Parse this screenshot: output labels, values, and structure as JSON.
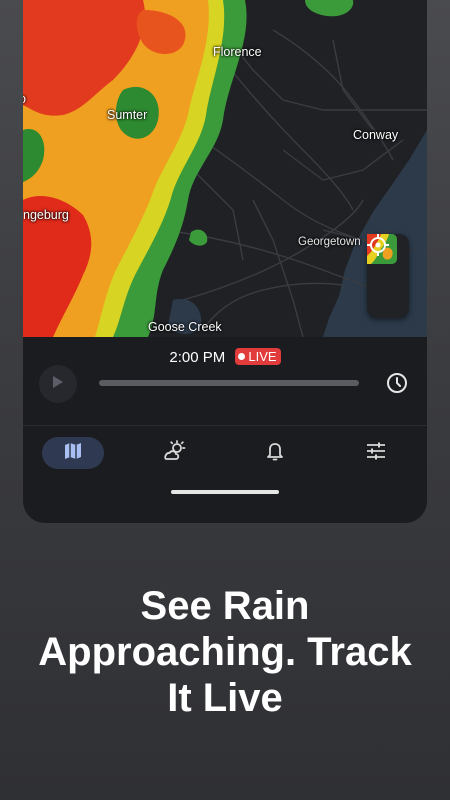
{
  "map": {
    "cities": {
      "florence": "Florence",
      "sumter": "Sumter",
      "conway": "Conway",
      "orangeburg": "ngeburg",
      "georgetown": "Georgetown",
      "goose_creek": "Goose Creek",
      "edge_fragment": "o"
    },
    "layer_button_icon": "radar-layer-thumbnail-icon",
    "locate_button_icon": "crosshair-icon"
  },
  "player": {
    "time": "2:00 PM",
    "live_label": "LIVE",
    "live_color": "#e23b3b",
    "progress": 1.0
  },
  "nav": {
    "items": [
      {
        "icon": "map-icon",
        "active": true
      },
      {
        "icon": "weather-icon",
        "active": false
      },
      {
        "icon": "bell-icon",
        "active": false
      },
      {
        "icon": "sliders-icon",
        "active": false
      }
    ],
    "active_color": "#2f3a52"
  },
  "headline": {
    "line1": "See Rain",
    "line2": "Approaching. Track",
    "line3": "It Live"
  }
}
